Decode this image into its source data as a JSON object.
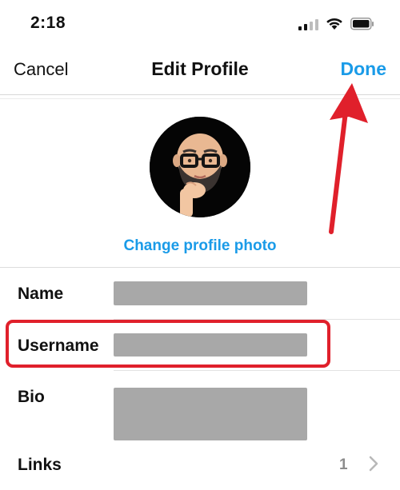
{
  "status_bar": {
    "time": "2:18",
    "icons": [
      "signal-icon",
      "wifi-icon",
      "battery-icon"
    ]
  },
  "nav": {
    "cancel_label": "Cancel",
    "title": "Edit Profile",
    "done_label": "Done"
  },
  "profile": {
    "change_photo_label": "Change profile photo"
  },
  "rows": {
    "name_label": "Name",
    "username_label": "Username",
    "bio_label": "Bio",
    "links_label": "Links",
    "links_count": "1"
  },
  "colors": {
    "accent": "#1a9be8",
    "annotation": "#e0202b",
    "redacted_field": "#a8a8a8"
  }
}
